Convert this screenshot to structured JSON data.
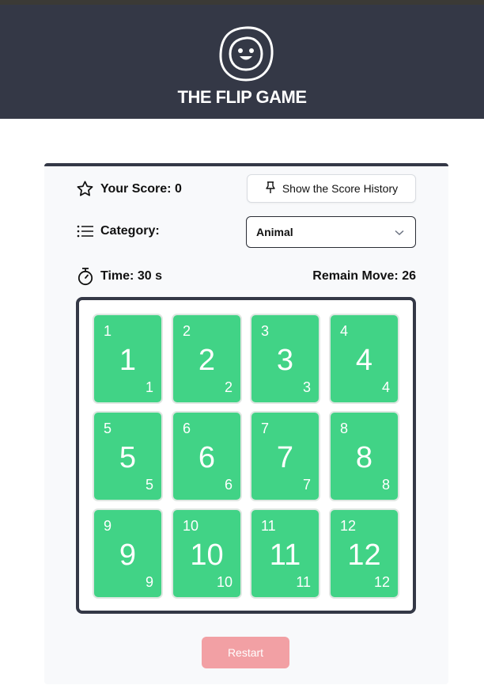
{
  "app": {
    "brand": "THE FLIP GAME"
  },
  "score": {
    "label": "Your Score: 0"
  },
  "history_button": {
    "label": "Show the Score History"
  },
  "category": {
    "label": "Category:",
    "selected": "Animal"
  },
  "timer": {
    "label": "Time: 30 s"
  },
  "moves": {
    "label": "Remain Move: 26"
  },
  "cards": [
    {
      "value": "1"
    },
    {
      "value": "2"
    },
    {
      "value": "3"
    },
    {
      "value": "4"
    },
    {
      "value": "5"
    },
    {
      "value": "6"
    },
    {
      "value": "7"
    },
    {
      "value": "8"
    },
    {
      "value": "9"
    },
    {
      "value": "10"
    },
    {
      "value": "11"
    },
    {
      "value": "12"
    }
  ],
  "restart_button": {
    "label": "Restart"
  },
  "colors": {
    "header": "#343846",
    "card": "#41d386",
    "restart": "#f2a0a4"
  },
  "icons": [
    "smiley-logo-icon",
    "star-icon",
    "pin-icon",
    "list-icon",
    "chevron-down-icon",
    "stopwatch-icon"
  ]
}
